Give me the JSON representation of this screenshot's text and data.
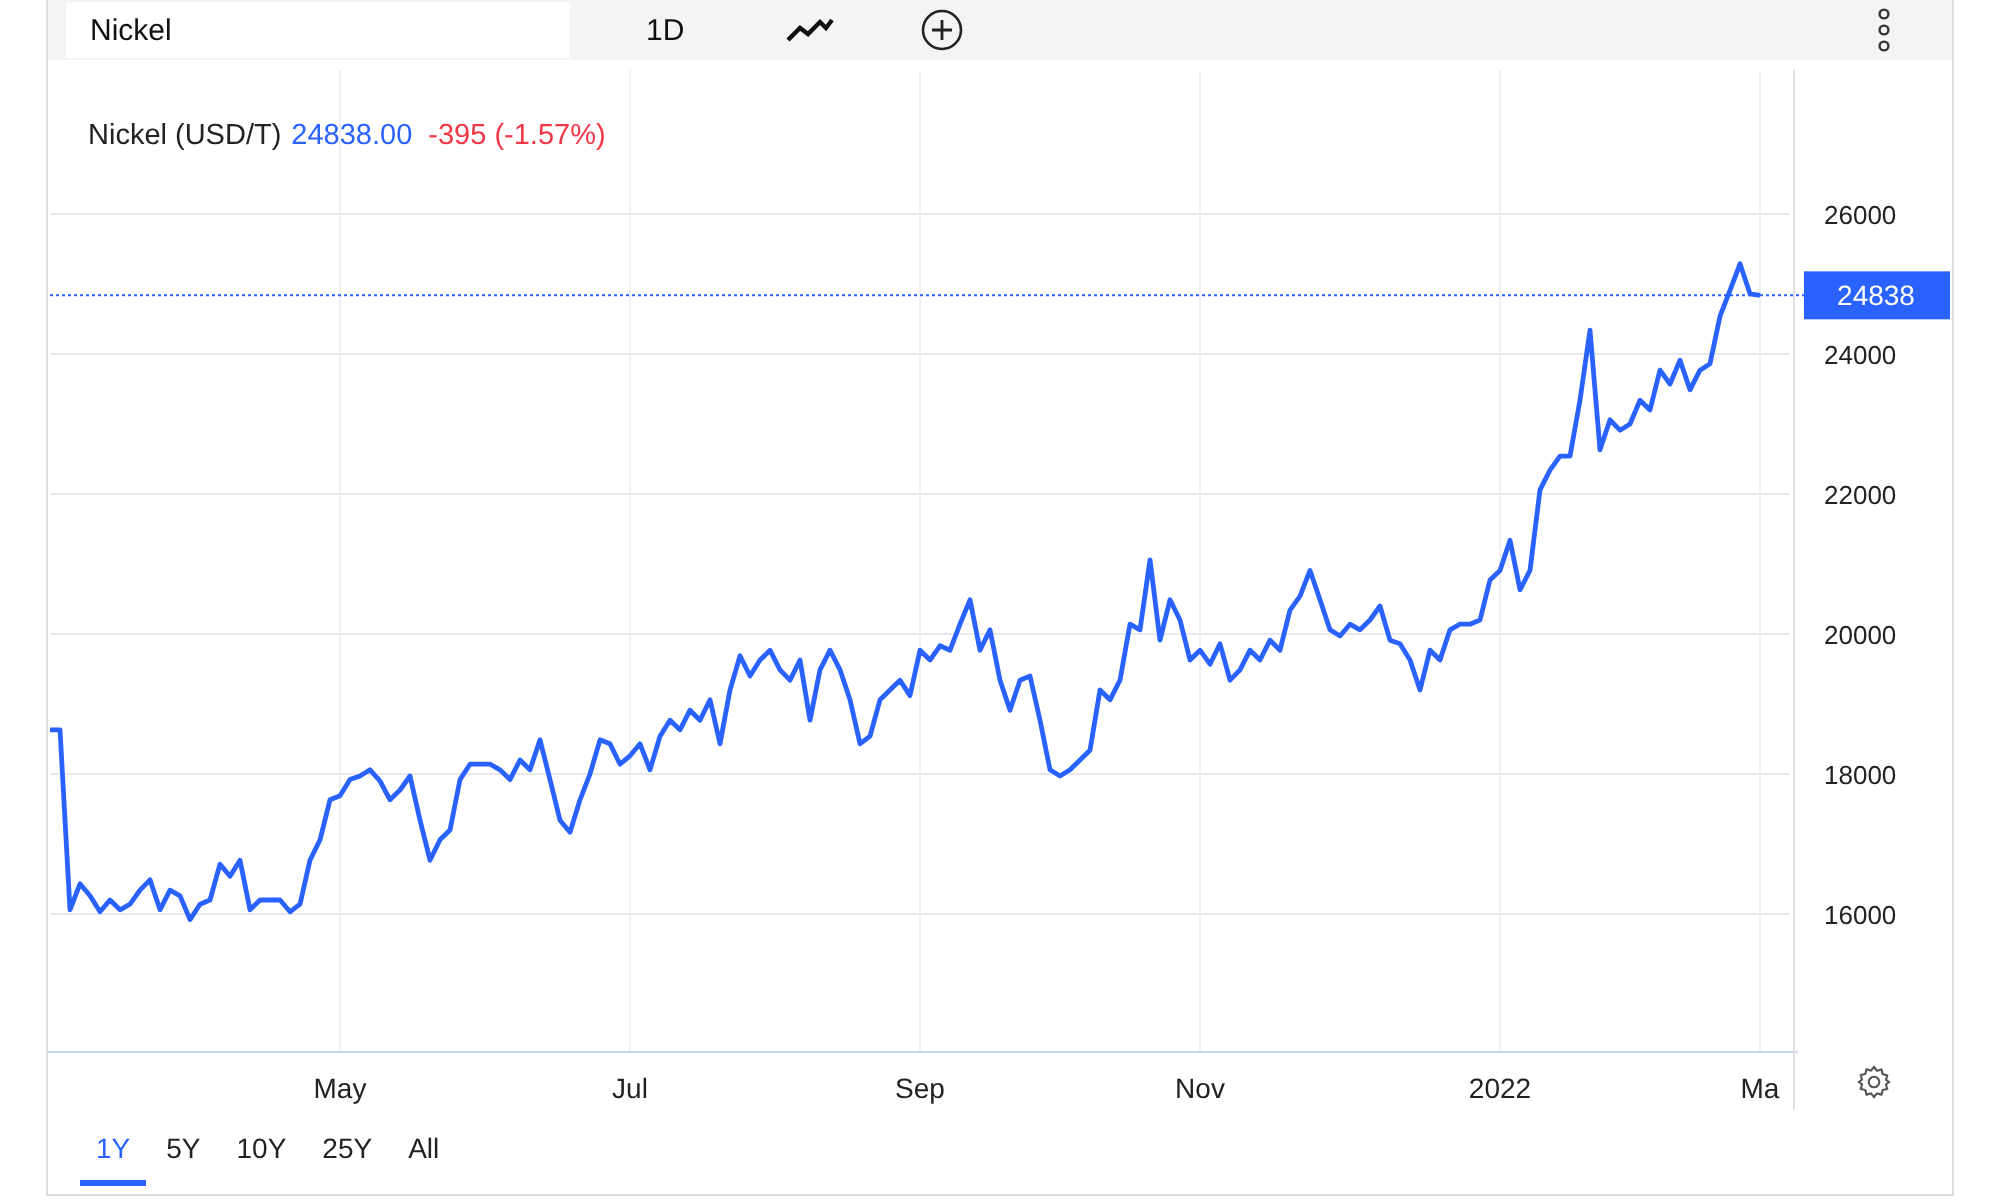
{
  "toolbar": {
    "search": {
      "value": "Nickel"
    },
    "interval": "1D"
  },
  "chart": {
    "legend": {
      "price": "24838.00",
      "change": "-395 (-1.57%)"
    },
    "chart_data": {
      "type": "line",
      "series": [
        {
          "name": "Nickel (USD/T)",
          "color": "#2962ff",
          "values": [
            18630,
            18630,
            16060,
            16430,
            16260,
            16030,
            16200,
            16060,
            16140,
            16340,
            16490,
            16060,
            16340,
            16260,
            15920,
            16140,
            16200,
            16710,
            16540,
            16770,
            16060,
            16200,
            16200,
            16200,
            16030,
            16140,
            16770,
            17060,
            17630,
            17690,
            17920,
            17970,
            18060,
            17900,
            17630,
            17770,
            17970,
            17340,
            16770,
            17060,
            17200,
            17920,
            18140,
            18140,
            18140,
            18060,
            17920,
            18200,
            18060,
            18490,
            17920,
            17340,
            17170,
            17630,
            18000,
            18490,
            18430,
            18140,
            18260,
            18430,
            18060,
            18540,
            18770,
            18630,
            18910,
            18770,
            19060,
            18430,
            19200,
            19690,
            19400,
            19630,
            19770,
            19490,
            19340,
            19630,
            18770,
            19490,
            19770,
            19490,
            19060,
            18430,
            18540,
            19060,
            19200,
            19340,
            19120,
            19770,
            19630,
            19830,
            19770,
            20140,
            20490,
            19770,
            20060,
            19340,
            18910,
            19340,
            19400,
            18770,
            18060,
            17970,
            18060,
            18200,
            18340,
            19200,
            19060,
            19340,
            20140,
            20060,
            21060,
            19910,
            20490,
            20200,
            19630,
            19770,
            19570,
            19860,
            19340,
            19490,
            19770,
            19630,
            19910,
            19770,
            20340,
            20540,
            20910,
            20490,
            20060,
            19970,
            20140,
            20060,
            20200,
            20400,
            19910,
            19860,
            19630,
            19200,
            19770,
            19630,
            20060,
            20140,
            20140,
            20200,
            20770,
            20910,
            21340,
            20630,
            20910,
            22060,
            22340,
            22540,
            22540,
            23340,
            24340,
            22630,
            23060,
            22910,
            23000,
            23340,
            23200,
            23770,
            23570,
            23910,
            23490,
            23770,
            23860,
            24540,
            24910,
            25290,
            24860,
            24838
          ]
        }
      ],
      "categories": [
        null,
        null,
        null,
        null,
        null,
        null,
        null,
        null,
        null,
        null,
        null,
        null,
        null,
        null,
        null,
        null,
        null,
        null,
        null,
        null,
        null,
        null,
        null,
        null,
        null,
        null,
        null,
        null,
        null,
        "May",
        null,
        null,
        null,
        null,
        null,
        null,
        null,
        null,
        null,
        null,
        null,
        null,
        null,
        null,
        null,
        null,
        null,
        null,
        null,
        null,
        null,
        null,
        null,
        null,
        null,
        null,
        null,
        null,
        "Jul",
        null,
        null,
        null,
        null,
        null,
        null,
        null,
        null,
        null,
        null,
        null,
        null,
        null,
        null,
        null,
        null,
        null,
        null,
        null,
        null,
        null,
        null,
        null,
        null,
        null,
        null,
        null,
        null,
        "Sep",
        null,
        null,
        null,
        null,
        null,
        null,
        null,
        null,
        null,
        null,
        null,
        null,
        null,
        null,
        null,
        null,
        null,
        null,
        null,
        null,
        null,
        null,
        null,
        null,
        null,
        null,
        null,
        "Nov",
        null,
        null,
        null,
        null,
        null,
        null,
        null,
        null,
        null,
        null,
        null,
        null,
        null,
        null,
        null,
        null,
        null,
        null,
        null,
        null,
        null,
        null,
        null,
        null,
        null,
        null,
        null,
        null,
        null,
        "2022",
        null,
        null,
        null,
        null,
        null,
        null,
        null,
        null,
        null,
        null,
        null,
        null,
        null,
        null,
        null,
        null,
        null,
        null,
        null,
        null,
        null,
        null,
        null,
        null,
        null,
        "Ma"
      ],
      "ylim": [
        14000,
        28000
      ],
      "grid": true,
      "ref_lines": [
        {
          "axis": "y",
          "value": 24838,
          "label": "24838",
          "color": "#2962ff"
        }
      ],
      "yticks": [
        16000,
        18000,
        20000,
        22000,
        24000,
        26000
      ]
    }
  },
  "ranges": [
    {
      "label": "1Y",
      "selected": true
    },
    {
      "label": "5Y",
      "selected": false
    },
    {
      "label": "10Y",
      "selected": false
    },
    {
      "label": "25Y",
      "selected": false
    },
    {
      "label": "All",
      "selected": false
    }
  ]
}
